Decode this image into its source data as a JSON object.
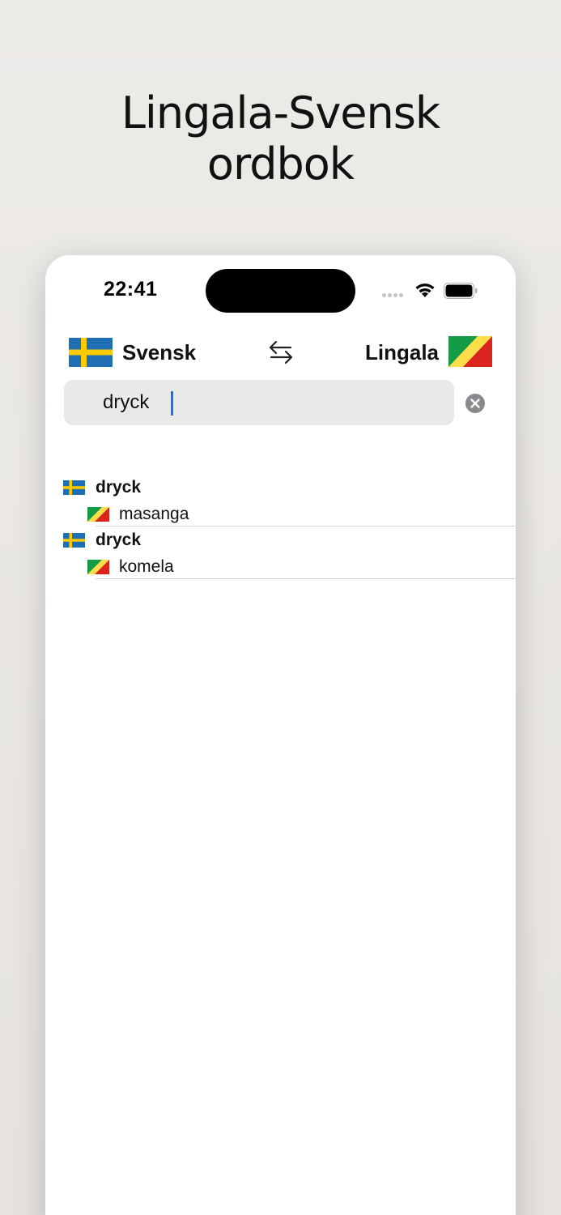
{
  "headline": {
    "line1": "Lingala-Svensk",
    "line2": "ordbok"
  },
  "status_bar": {
    "time": "22:41"
  },
  "language_bar": {
    "source_language": "Svensk",
    "target_language": "Lingala",
    "source_flag": "sweden-flag",
    "target_flag": "congo-flag",
    "swap_icon": "swap-arrows-icon"
  },
  "search": {
    "value": "dryck",
    "clear_icon": "clear-circle-icon"
  },
  "results": [
    {
      "source": "dryck",
      "target": "masanga"
    },
    {
      "source": "dryck",
      "target": "komela"
    }
  ],
  "colors": {
    "accent_caret": "#1a73e8",
    "sweden_blue": "#1f6fb5",
    "sweden_yellow": "#fecb00",
    "congo_green": "#159b45",
    "congo_yellow": "#fbde4a",
    "congo_red": "#dc241f",
    "background": "#edebe8"
  }
}
